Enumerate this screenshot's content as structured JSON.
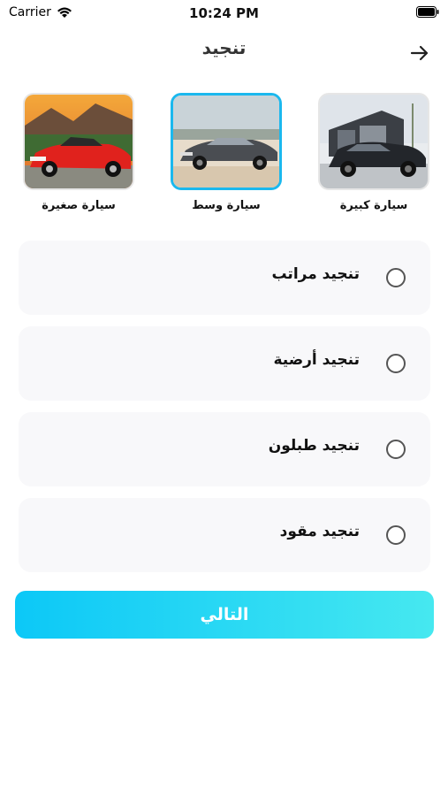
{
  "status_bar": {
    "carrier": "Carrier",
    "time": "10:24 PM",
    "icons": [
      "wifi-icon",
      "battery-icon"
    ]
  },
  "header": {
    "title": "تنجيد",
    "back_icon": "arrow-right-icon"
  },
  "car_types": [
    {
      "label": "سيارة كبيرة",
      "image": "black-suv-photo",
      "selected": false
    },
    {
      "label": "سيارة وسط",
      "image": "gray-sedan-photo",
      "selected": true
    },
    {
      "label": "سيارة صغيرة",
      "image": "red-convertible-photo",
      "selected": false
    }
  ],
  "options": [
    {
      "label": "تنجيد مراتب"
    },
    {
      "label": "تنجيد أرضية"
    },
    {
      "label": "تنجيد طبلون"
    },
    {
      "label": "تنجيد مقود"
    }
  ],
  "next_button": {
    "label": "التالي"
  },
  "colors": {
    "accent": "#1bb8ee",
    "button_gradient_start": "#0cc8f7",
    "button_gradient_end": "#46e8f0",
    "option_bg": "#f8f8fa"
  }
}
